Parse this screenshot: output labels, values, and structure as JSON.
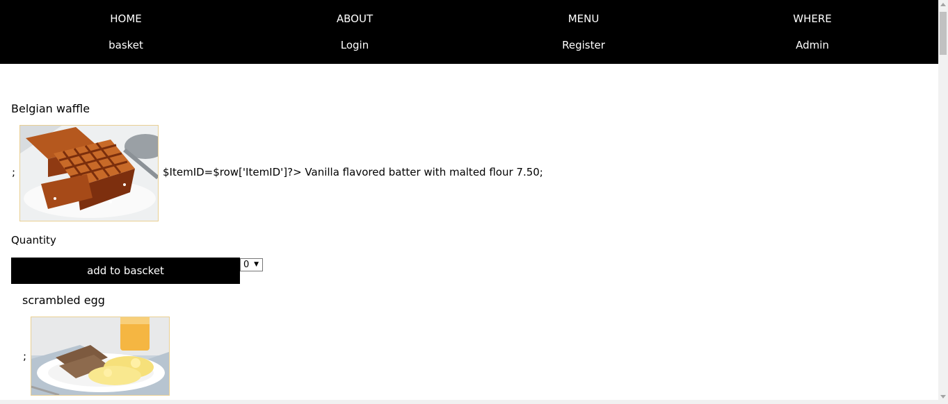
{
  "nav": {
    "home": "HOME",
    "about": "ABOUT",
    "menu": "MENU",
    "where": "WHERE",
    "basket": "basket",
    "login": "Login",
    "register": "Register",
    "admin": "Admin"
  },
  "items": [
    {
      "name": "Belgian waffle",
      "prefix": ";",
      "description": "$ItemID=$row['ItemID']?> Vanilla flavored batter with malted flour 7.50;",
      "image_icon": "waffle-photo"
    },
    {
      "name": "scrambled egg",
      "prefix": ";",
      "image_icon": "scrambled-egg-photo"
    }
  ],
  "order": {
    "quantity_label": "Quantity",
    "add_button": "add to bascket",
    "quantity_value": "0"
  },
  "colors": {
    "nav_background": "#000000",
    "nav_text": "#ffffff",
    "image_border": "#e9cf92"
  }
}
